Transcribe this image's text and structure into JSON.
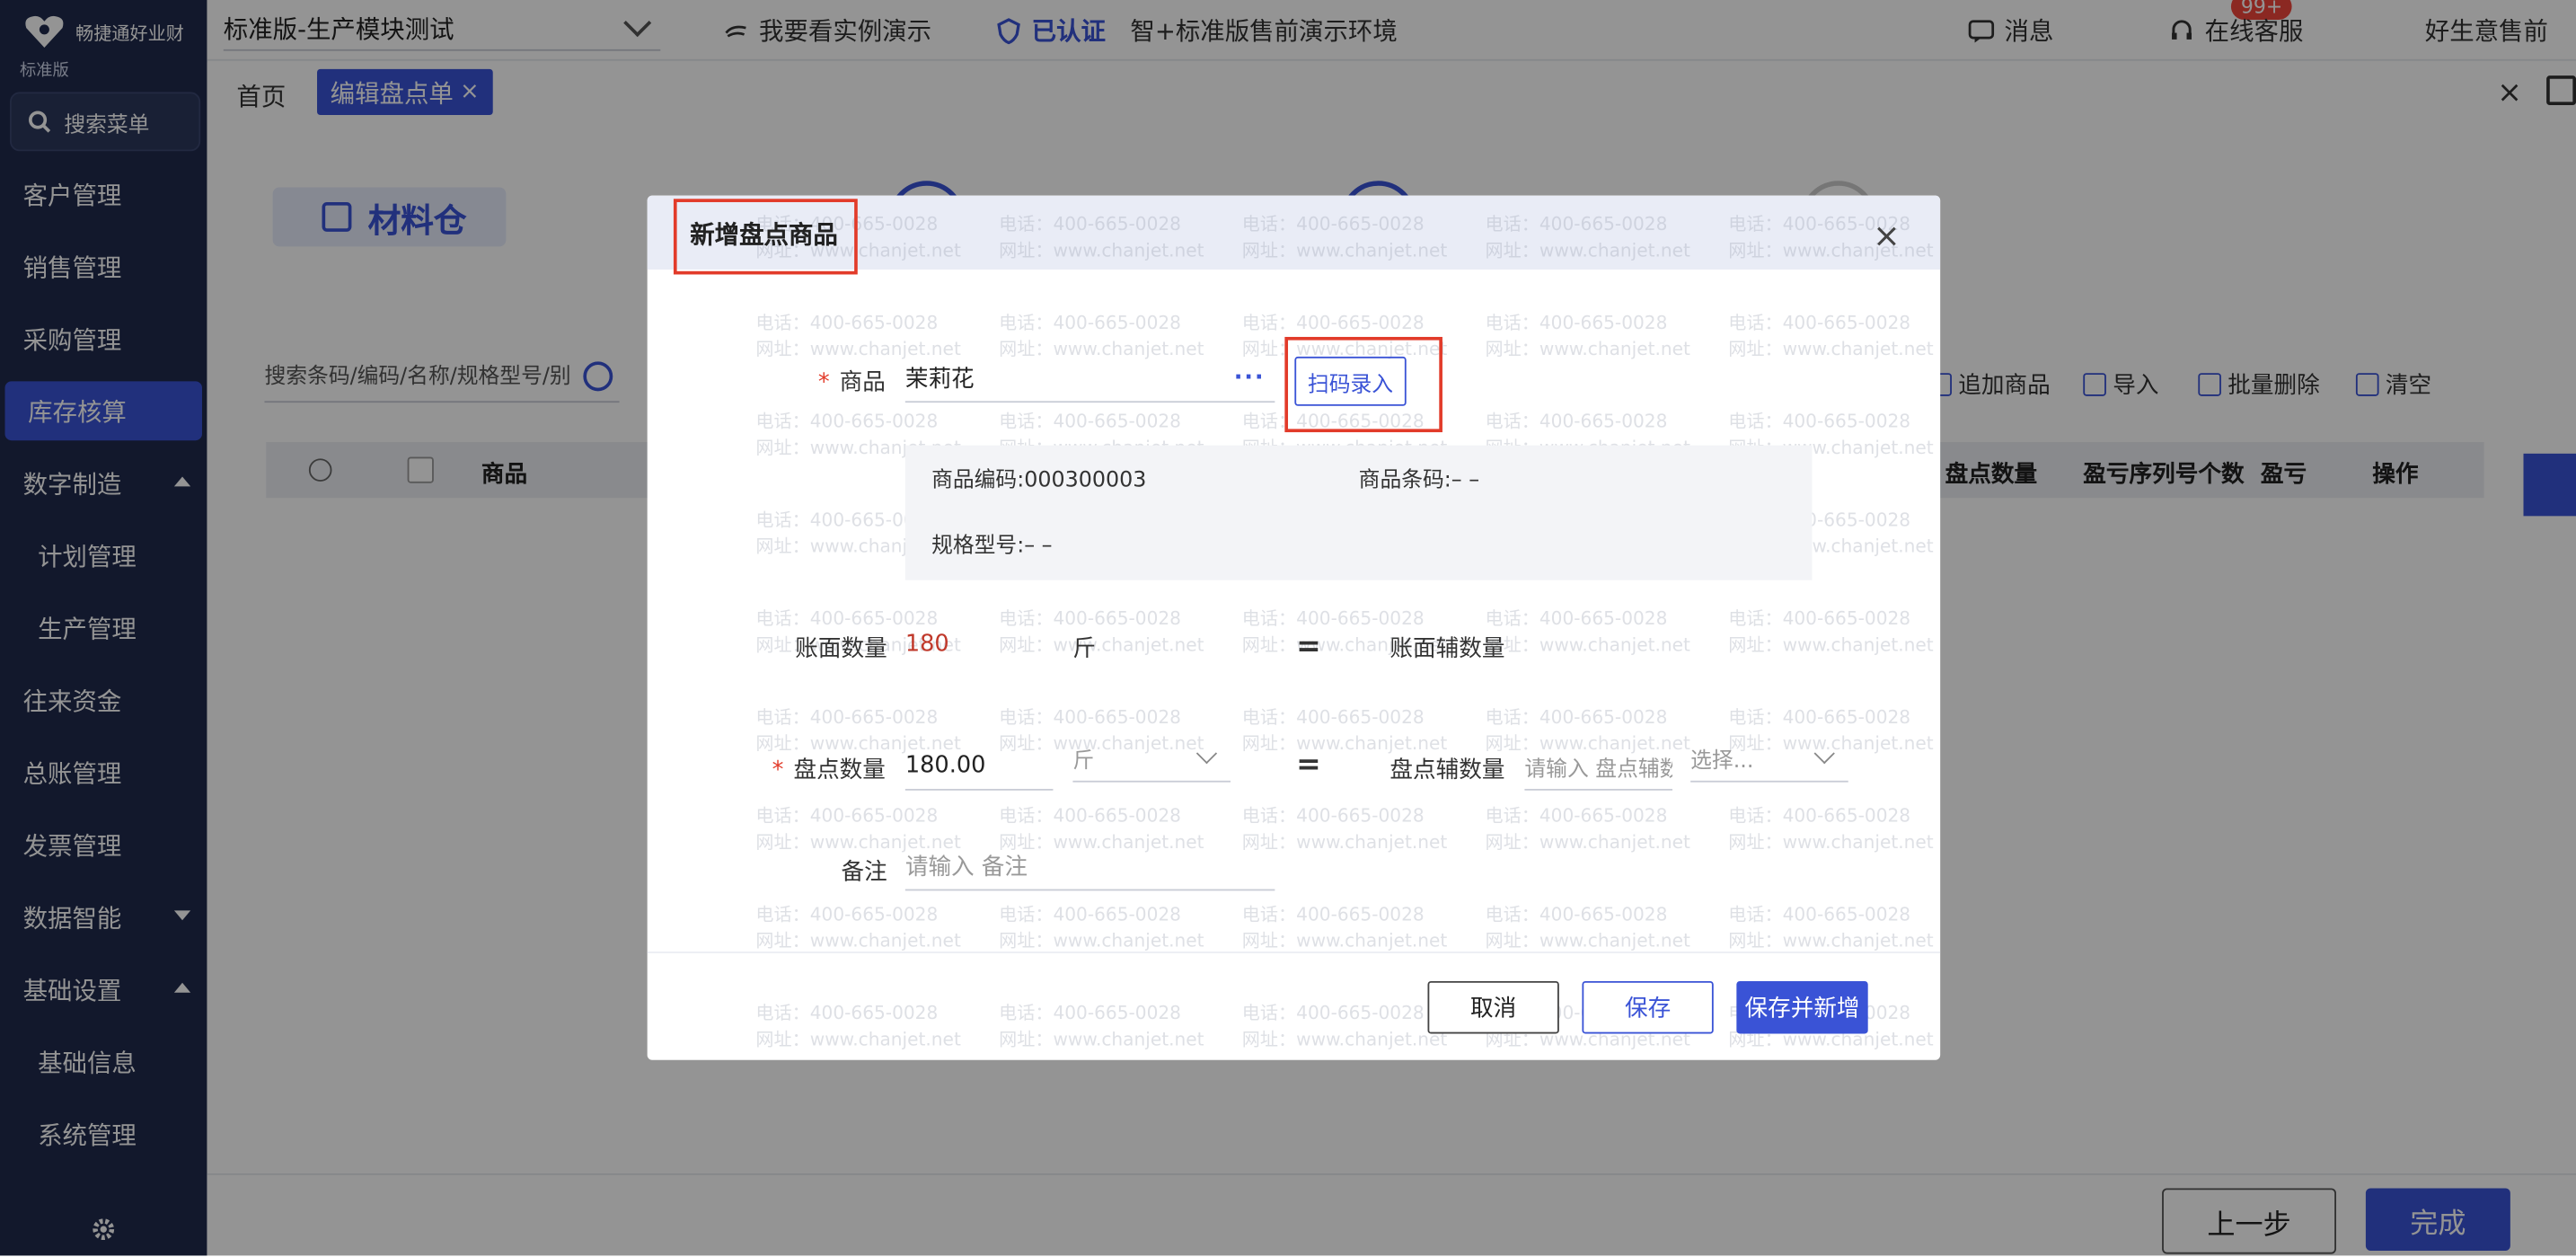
{
  "brand": {
    "name": "畅捷通好业财",
    "edition": "标准版"
  },
  "sidebar": {
    "search_placeholder": "搜索菜单",
    "items": [
      {
        "label": "客户管理",
        "expand": ""
      },
      {
        "label": "销售管理",
        "expand": ""
      },
      {
        "label": "采购管理",
        "expand": ""
      },
      {
        "label": "库存核算",
        "expand": "",
        "active": true
      },
      {
        "label": "数字制造",
        "expand": "up"
      },
      {
        "label": "计划管理",
        "expand": "",
        "sub": true
      },
      {
        "label": "生产管理",
        "expand": "",
        "sub": true
      },
      {
        "label": "往来资金",
        "expand": ""
      },
      {
        "label": "总账管理",
        "expand": ""
      },
      {
        "label": "发票管理",
        "expand": ""
      },
      {
        "label": "数据智能",
        "expand": "down"
      },
      {
        "label": "基础设置",
        "expand": "up"
      },
      {
        "label": "基础信息",
        "expand": "",
        "sub": true
      },
      {
        "label": "系统管理",
        "expand": "",
        "sub": true
      }
    ]
  },
  "topbar": {
    "account_select": "标准版-生产模块测试",
    "demo_link": "我要看实例演示",
    "verified": "已认证",
    "env_name": "智+标准版售前演示环境",
    "messages": "消息",
    "messages_badge": "99+",
    "support": "在线客服",
    "user_name": "好生意售前"
  },
  "tabs": {
    "home": "首页",
    "active": "编辑盘点单",
    "active_close": "×",
    "close_all": "×"
  },
  "main": {
    "warehouse": "材料仓",
    "search_placeholder": "搜索条码/编码/名称/规格型号/别",
    "actions": [
      "追加商品",
      "导入",
      "批量删除",
      "清空"
    ],
    "table_headers": [
      "商品",
      "盘点数量",
      "盈亏序列号个数",
      "盈亏",
      "操作"
    ]
  },
  "watermark": {
    "phone": "电话：400-665-0028",
    "site": "网址：www.chanjet.net"
  },
  "modal": {
    "title": "新增盘点商品",
    "close": "×",
    "product_label": "商品",
    "product_value": "茉莉花",
    "product_more": "···",
    "scan_button": "扫码录入",
    "product_code": "商品编码:000300003",
    "product_barcode": "商品条码:– –",
    "product_spec": "规格型号:– –",
    "book_qty_label": "账面数量",
    "book_qty_value": "180",
    "book_unit": "斤",
    "equals": "=",
    "book_aux_label": "账面辅数量",
    "count_qty_label": "盘点数量",
    "count_qty_value": "180.00",
    "count_unit": "斤",
    "count_aux_label": "盘点辅数量",
    "count_aux_placeholder": "请输入 盘点辅数",
    "aux_unit_placeholder": "选择...",
    "remark_label": "备注",
    "remark_placeholder": "请输入 备注",
    "buttons": {
      "cancel": "取消",
      "save": "保存",
      "save_new": "保存并新增"
    }
  },
  "bottom": {
    "prev": "上一步",
    "done": "完成"
  },
  "colors": {
    "primary": "#3a53d6",
    "sidebar": "#1f2a4d",
    "highlight": "#e23b2a",
    "required": "#e23b2a",
    "book_qty": "#c0392b"
  }
}
